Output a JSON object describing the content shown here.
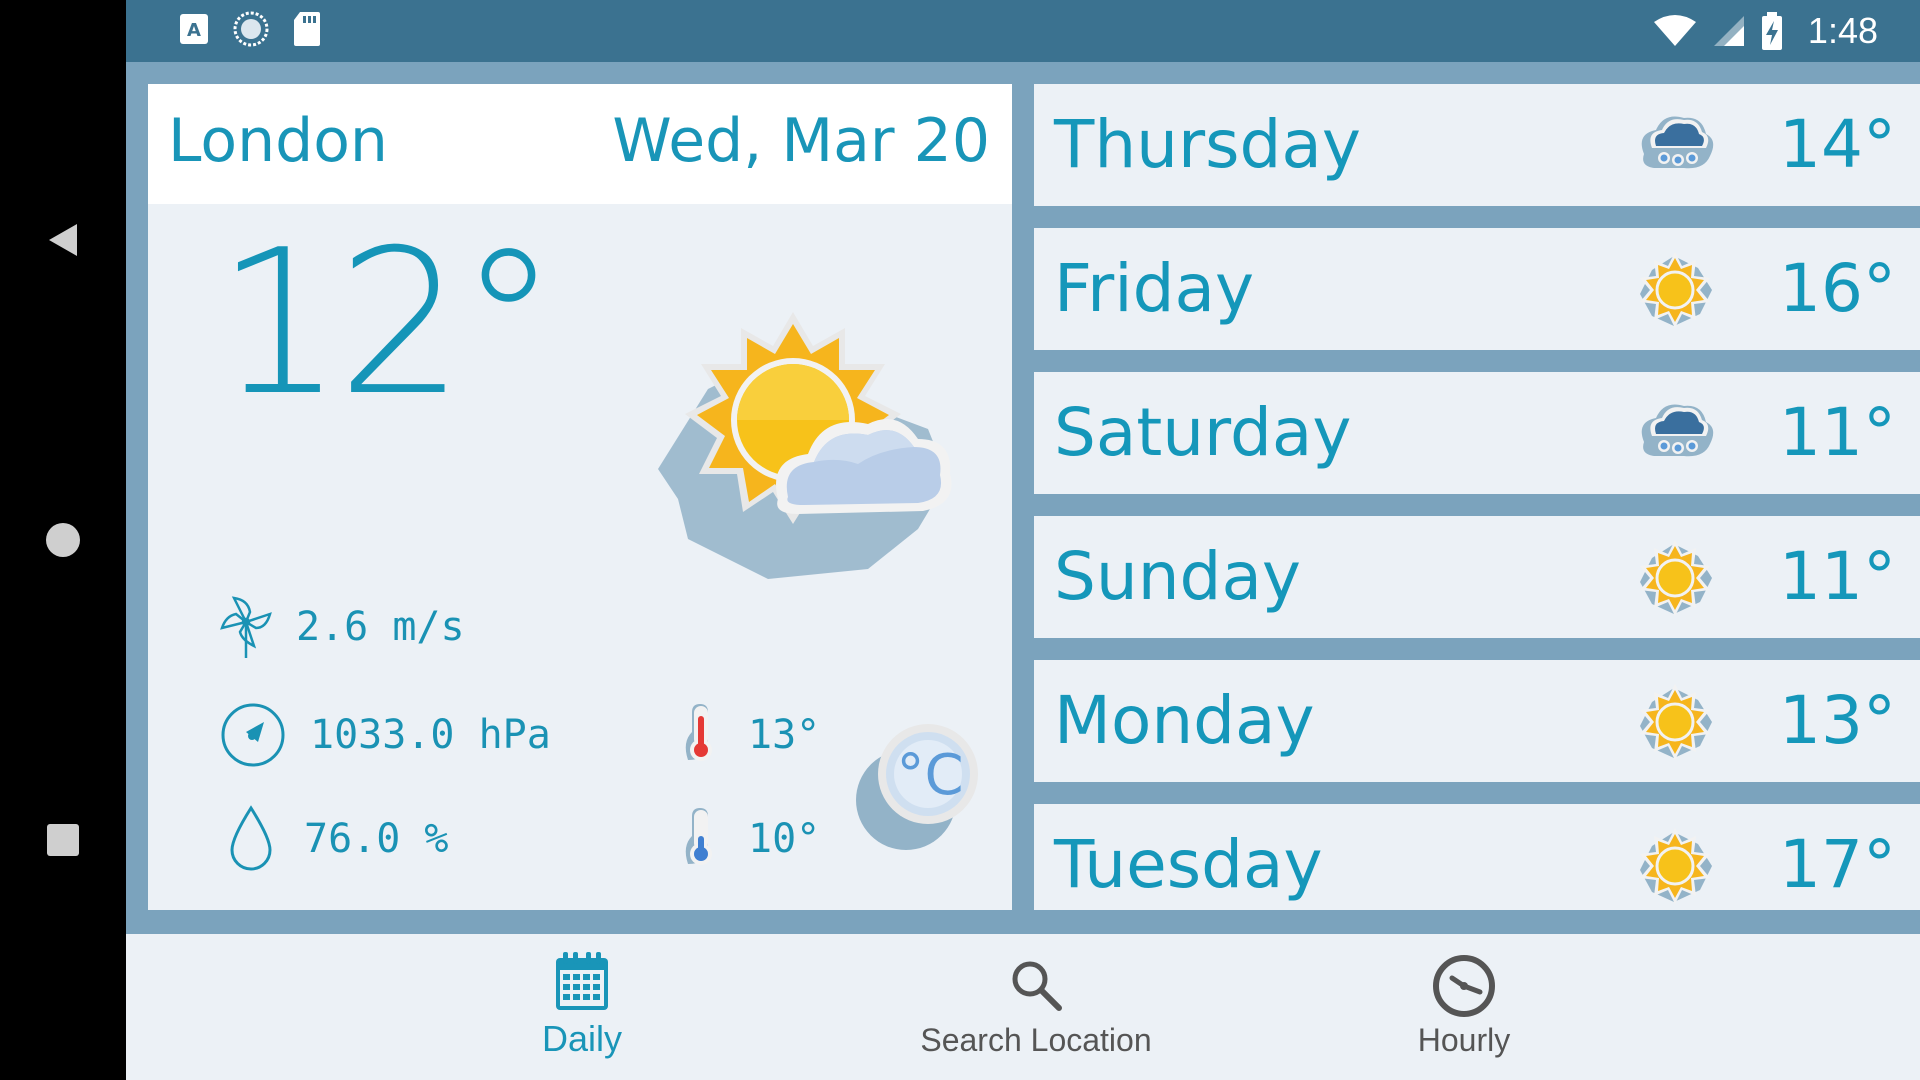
{
  "status_bar": {
    "time": "1:48"
  },
  "current": {
    "city": "London",
    "date": "Wed, Mar 20",
    "temperature": "12°",
    "wind": "2.6 m/s",
    "pressure": "1033.0 hPa",
    "humidity": "76.0 %",
    "temp_max": "13°",
    "temp_min": "10°",
    "unit_symbol": "°C",
    "condition_icon": "partly-cloudy-icon"
  },
  "forecast": [
    {
      "day": "Thursday",
      "temp": "14°",
      "icon": "rain-cloud-icon"
    },
    {
      "day": "Friday",
      "temp": "16°",
      "icon": "sun-icon"
    },
    {
      "day": "Saturday",
      "temp": "11°",
      "icon": "rain-cloud-icon"
    },
    {
      "day": "Sunday",
      "temp": "11°",
      "icon": "sun-icon"
    },
    {
      "day": "Monday",
      "temp": "13°",
      "icon": "sun-icon"
    },
    {
      "day": "Tuesday",
      "temp": "17°",
      "icon": "sun-icon"
    }
  ],
  "bottom_nav": {
    "daily": "Daily",
    "search": "Search Location",
    "hourly": "Hourly",
    "active": "daily"
  },
  "colors": {
    "accent": "#1995b8",
    "status_bar": "#3b7290",
    "background": "#7ba3bd",
    "card": "#ecf1f6",
    "inactive_text": "#555555"
  }
}
